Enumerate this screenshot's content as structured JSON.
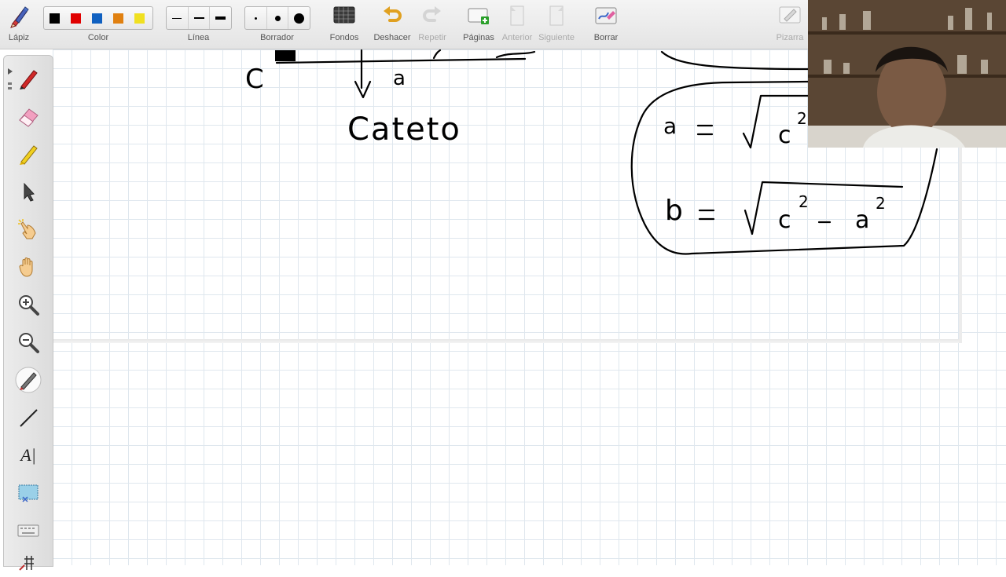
{
  "toolbar": {
    "lapiz": "Lápiz",
    "color": "Color",
    "linea": "Línea",
    "borrador": "Borrador",
    "fondos": "Fondos",
    "deshacer": "Deshacer",
    "repetir": "Repetir",
    "paginas": "Páginas",
    "anterior": "Anterior",
    "siguiente": "Siguiente",
    "borrar": "Borrar",
    "pizarra": "Pizarra",
    "colors": [
      "#000000",
      "#e00000",
      "#1060c0",
      "#e08010",
      "#f0e020"
    ]
  },
  "palette": {
    "tools": [
      "pen-tool",
      "eraser-tool",
      "highlighter-tool",
      "select-arrow-tool",
      "pointer-hand-tool",
      "pan-hand-tool",
      "zoom-in-tool",
      "zoom-out-tool",
      "pen-width-tool",
      "line-tool",
      "text-tool",
      "screen-capture-tool",
      "keyboard-tool",
      "grid-tool"
    ],
    "text_tool_label": "A|"
  },
  "board": {
    "label_c": "C",
    "label_a": "a",
    "word": "Cateto",
    "formula_a": [
      "a",
      "=",
      "c",
      "2"
    ],
    "formula_b": [
      "b",
      "=",
      "c",
      "2",
      "-",
      "a",
      "2"
    ]
  }
}
